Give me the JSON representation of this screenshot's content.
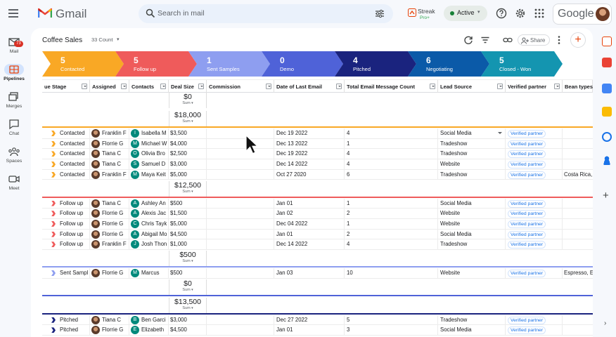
{
  "app": {
    "name": "Gmail",
    "search_placeholder": "Search in mail",
    "brand": "Google"
  },
  "streak": {
    "name": "Streak",
    "tier": "Pro+"
  },
  "status": {
    "label": "Active"
  },
  "rail": [
    {
      "label": "Mail",
      "icon": "mail-icon",
      "badge": "73"
    },
    {
      "label": "Pipelines",
      "icon": "pipelines-icon"
    },
    {
      "label": "Merges",
      "icon": "merges-icon"
    },
    {
      "label": "Chat",
      "icon": "chat-icon"
    },
    {
      "label": "Spaces",
      "icon": "spaces-icon"
    },
    {
      "label": "Meet",
      "icon": "meet-icon"
    }
  ],
  "pipeline": {
    "title": "Coffee Sales",
    "count": "33 Count",
    "share_label": "Share"
  },
  "stages": [
    {
      "count": "5",
      "name": "Contacted",
      "color": "#f9a825"
    },
    {
      "count": "5",
      "name": "Follow up",
      "color": "#ef5b5b"
    },
    {
      "count": "1",
      "name": "Sent Samples",
      "color": "#8e9ef0"
    },
    {
      "count": "0",
      "name": "Demo",
      "color": "#4f62d8"
    },
    {
      "count": "4",
      "name": "Pitched",
      "color": "#1a237e"
    },
    {
      "count": "6",
      "name": "Negotiating",
      "color": "#0b5aa8"
    },
    {
      "count": "5",
      "name": "Closed - Won",
      "color": "#1495b0"
    }
  ],
  "columns": [
    "ue Stage",
    "Assigned",
    "Contacts",
    "Deal Size",
    "Commission",
    "Date of Last Email",
    "Total Email Message Count",
    "Lead Source",
    "Verified partner",
    "Bean types"
  ],
  "groups": [
    {
      "sum": "$0",
      "sum_label": "Sum",
      "color": "#ffffff",
      "rows": []
    },
    {
      "sum": "$18,000",
      "sum_label": "Sum",
      "color": "#f9a825",
      "rows": [
        {
          "stage": "Contacted",
          "assigned": "Franklin F",
          "contact_initial": "I",
          "contact": "Isabella M",
          "deal": "$3,500",
          "date": "Dec 19 2022",
          "emails": "4",
          "source": "Social Media",
          "verified": "Verified partner",
          "bean": ""
        },
        {
          "stage": "Contacted",
          "assigned": "Florrie G",
          "contact_initial": "M",
          "contact": "Michael W",
          "deal": "$4,000",
          "date": "Dec 13 2022",
          "emails": "1",
          "source": "Tradeshow",
          "verified": "Verified partner",
          "bean": ""
        },
        {
          "stage": "Contacted",
          "assigned": "Tiana C",
          "contact_initial": "O",
          "contact": "Olivia Bro",
          "deal": "$2,500",
          "date": "Dec 19 2022",
          "emails": "4",
          "source": "Tradeshow",
          "verified": "Verified partner",
          "bean": ""
        },
        {
          "stage": "Contacted",
          "assigned": "Tiana C",
          "contact_initial": "S",
          "contact": "Samuel D",
          "deal": "$3,000",
          "date": "Dec 14 2022",
          "emails": "4",
          "source": "Website",
          "verified": "Verified partner",
          "bean": ""
        },
        {
          "stage": "Contacted",
          "assigned": "Franklin F",
          "contact_initial": "M",
          "contact": "Maya Keit",
          "deal": "$5,000",
          "date": "Oct 27 2020",
          "emails": "6",
          "source": "Tradeshow",
          "verified": "Verified partner",
          "bean": "Costa Rica,"
        }
      ]
    },
    {
      "sum": "$12,500",
      "sum_label": "Sum",
      "color": "#ef5b5b",
      "rows": [
        {
          "stage": "Follow up",
          "assigned": "Tiana C",
          "contact_initial": "A",
          "contact": "Ashley An",
          "deal": "$500",
          "date": "Jan 01",
          "emails": "1",
          "source": "Social Media",
          "verified": "Verified partner",
          "bean": ""
        },
        {
          "stage": "Follow up",
          "assigned": "Florrie G",
          "contact_initial": "A",
          "contact": "Alexis Jac",
          "deal": "$1,500",
          "date": "Jan 02",
          "emails": "2",
          "source": "Website",
          "verified": "Verified partner",
          "bean": ""
        },
        {
          "stage": "Follow up",
          "assigned": "Florrie G",
          "contact_initial": "C",
          "contact": "Chris Tayk",
          "deal": "$5,000",
          "date": "Dec 04 2022",
          "emails": "1",
          "source": "Website",
          "verified": "Verified partner",
          "bean": ""
        },
        {
          "stage": "Follow up",
          "assigned": "Florrie G",
          "contact_initial": "A",
          "contact": "Abigail Mo",
          "deal": "$4,500",
          "date": "Jan 01",
          "emails": "2",
          "source": "Social Media",
          "verified": "Verified partner",
          "bean": ""
        },
        {
          "stage": "Follow up",
          "assigned": "Franklin F",
          "contact_initial": "J",
          "contact": "Josh Thon",
          "deal": "$1,000",
          "date": "Dec 14 2022",
          "emails": "4",
          "source": "Tradeshow",
          "verified": "Verified partner",
          "bean": ""
        }
      ]
    },
    {
      "sum": "$500",
      "sum_label": "Sum",
      "color": "#8e9ef0",
      "rows": [
        {
          "stage": "Sent Sampl",
          "assigned": "Florrie G",
          "contact_initial": "M",
          "contact": "Marcus",
          "deal": "$500",
          "date": "Jan 03",
          "emails": "10",
          "source": "Website",
          "verified": "Verified partner",
          "bean": "Espresso, E"
        }
      ]
    },
    {
      "sum": "$0",
      "sum_label": "Sum",
      "color": "#4f62d8",
      "rows": []
    },
    {
      "sum": "$13,500",
      "sum_label": "Sum",
      "color": "#1a237e",
      "rows": [
        {
          "stage": "Pitched",
          "assigned": "Tiana C",
          "contact_initial": "B",
          "contact": "Ben Garci",
          "deal": "$3,000",
          "date": "Dec 27 2022",
          "emails": "5",
          "source": "Tradeshow",
          "verified": "Verified partner",
          "bean": ""
        },
        {
          "stage": "Pitched",
          "assigned": "Florrie G",
          "contact_initial": "E",
          "contact": "Elizabeth",
          "deal": "$4,500",
          "date": "Jan 01",
          "emails": "3",
          "source": "Social Media",
          "verified": "Verified partner",
          "bean": ""
        }
      ]
    }
  ]
}
